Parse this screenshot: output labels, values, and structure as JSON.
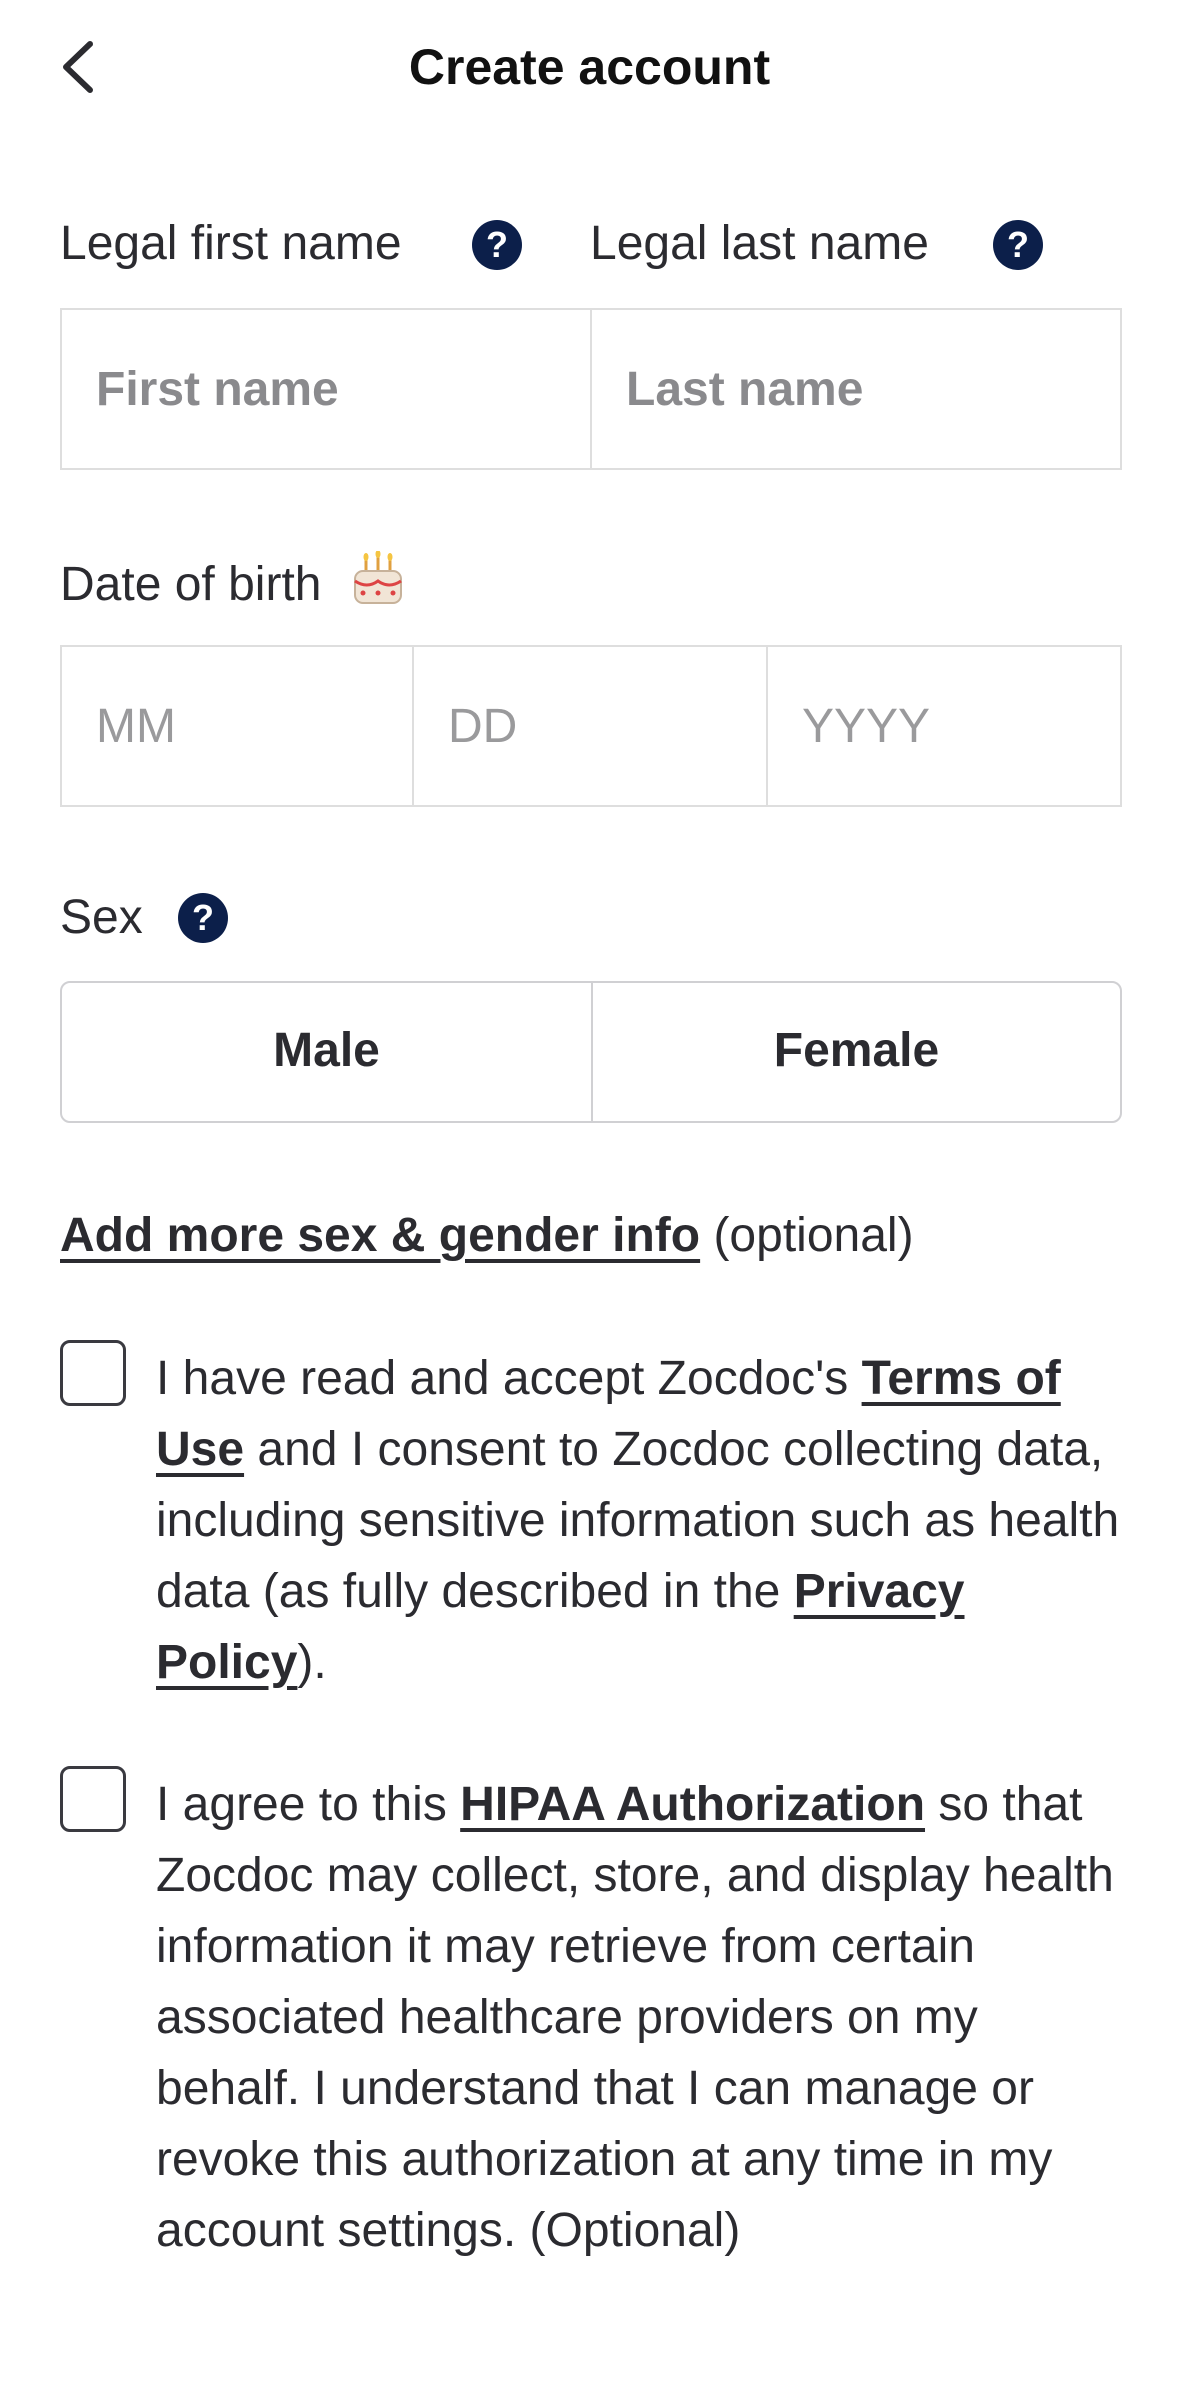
{
  "header": {
    "title": "Create account",
    "back_icon": "chevron-left-icon"
  },
  "first_name": {
    "label": "Legal first name",
    "placeholder": "First name",
    "value": ""
  },
  "last_name": {
    "label": "Legal last name",
    "placeholder": "Last name",
    "value": ""
  },
  "dob": {
    "label": "Date of birth",
    "icon": "birthday-cake-icon",
    "month_placeholder": "MM",
    "day_placeholder": "DD",
    "year_placeholder": "YYYY"
  },
  "sex": {
    "label": "Sex",
    "options": [
      "Male",
      "Female"
    ]
  },
  "help_glyph": "?",
  "gender_info": {
    "link": "Add more sex & gender info",
    "suffix": " (optional)"
  },
  "terms": {
    "checked": false,
    "text_1": "I have read and accept Zocdoc's ",
    "link_terms": "Terms of Use",
    "text_2": " and I consent to Zocdoc collecting data, including sensitive information such as health data (as fully described in the ",
    "link_privacy": "Privacy Policy",
    "text_3": ")."
  },
  "hipaa": {
    "checked": false,
    "text_1": "I agree to this ",
    "link": "HIPAA Authorization",
    "text_2": " so that Zocdoc may collect, store, and display health information it may retrieve from certain associated healthcare providers on my behalf. I understand that I can manage or revoke this authorization at any time in my account settings. (Optional)"
  },
  "colors": {
    "help_badge": "#0c1f4a",
    "border": "#dedede",
    "text": "#2b2b30"
  }
}
